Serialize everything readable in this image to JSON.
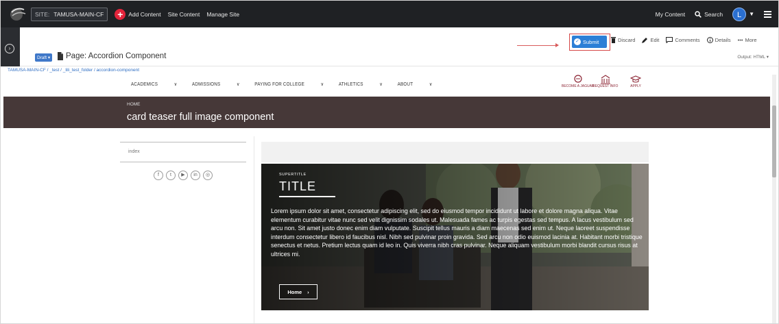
{
  "topbar": {
    "site_label": "SITE:",
    "site_name": "TAMUSA-MAIN-CF",
    "add_content": "Add Content",
    "site_content": "Site Content",
    "manage_site": "Manage Site",
    "my_content": "My Content",
    "search": "Search",
    "avatar_initial": "L"
  },
  "page": {
    "draft_label": "Draft",
    "title": "Page: Accordion Component",
    "submit": "Submit",
    "discard": "Discard",
    "edit": "Edit",
    "comments": "Comments",
    "details": "Details",
    "more": "More",
    "output": "Output: HTML"
  },
  "breadcrumb": "TAMUSA-MAIN-CF / _test / _lili_test_folder / accordion-component",
  "preview": {
    "nav": [
      "ACADEMICS",
      "ADMISSIONS",
      "PAYING FOR COLLEGE",
      "ATHLETICS",
      "ABOUT"
    ],
    "utility": [
      "BECOME A JAGUAR",
      "REQUEST INFO",
      "APPLY"
    ],
    "banner_crumb": "HOME",
    "banner_title": "card teaser full image component",
    "index_label": "index",
    "card": {
      "supertitle": "SUPERTITLE",
      "title": "TITLE",
      "body": "Lorem ipsum dolor sit amet, consectetur adipiscing elit, sed do eiusmod tempor incididunt ut labore et dolore magna aliqua. Vitae elementum curabitur vitae nunc sed velit dignissim sodales ut. Malesuada fames ac turpis egestas sed tempus. A lacus vestibulum sed arcu non. Sit amet justo donec enim diam vulputate. Suscipit tellus mauris a diam maecenas sed enim ut. Neque laoreet suspendisse interdum consectetur libero id faucibus nisl. Nibh sed pulvinar proin gravida. Sed arcu non odio euismod lacinia at. Habitant morbi tristique senectus et netus. Pretium lectus quam id leo in. Quis viverra nibh cras pulvinar. Neque aliquam vestibulum morbi blandit cursus risus at ultrices mi.",
      "button": "Home"
    }
  },
  "colors": {
    "topbar": "#1f2124",
    "accent_blue": "#2c7fd6",
    "add_red": "#e3243b",
    "banner": "#463838",
    "brand_maroon": "#8b2332"
  }
}
